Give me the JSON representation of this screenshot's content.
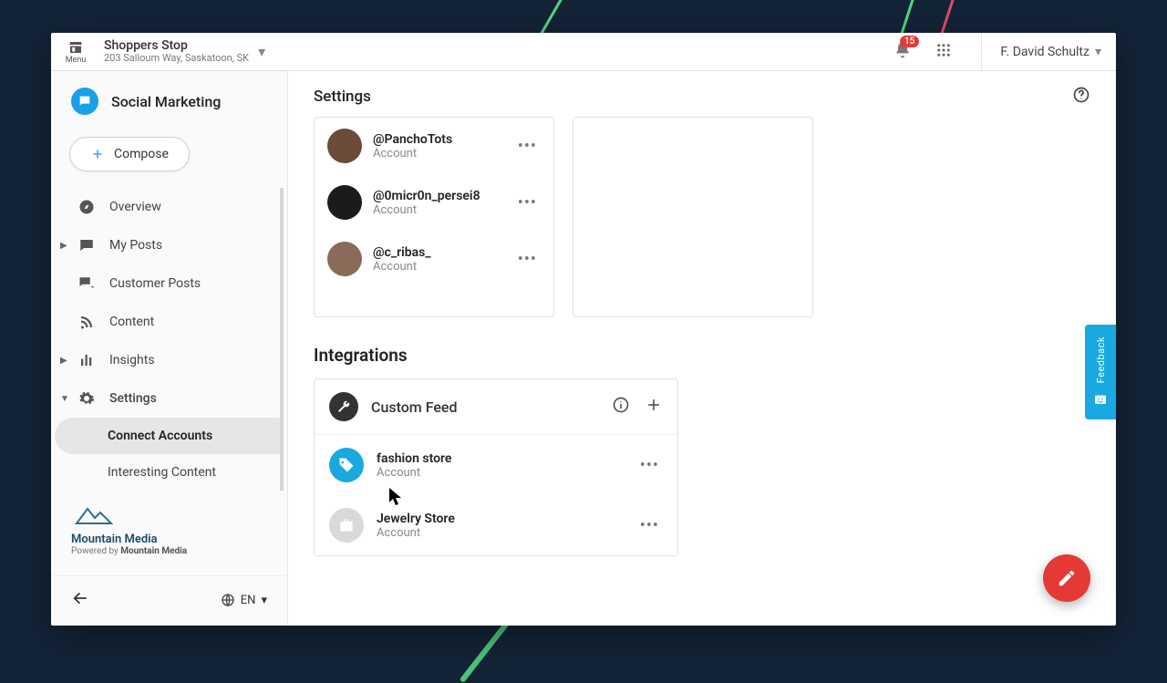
{
  "topbar": {
    "menu_label": "Menu",
    "location_name": "Shoppers Stop",
    "location_address": "203 Salloum Way, Saskatoon, SK",
    "notification_count": "15",
    "user_name": "F. David Schultz"
  },
  "sidebar": {
    "brand": "Social Marketing",
    "compose_label": "Compose",
    "items": [
      {
        "label": "Overview"
      },
      {
        "label": "My Posts"
      },
      {
        "label": "Customer Posts"
      },
      {
        "label": "Content"
      },
      {
        "label": "Insights"
      },
      {
        "label": "Settings"
      }
    ],
    "sub_items": [
      {
        "label": "Connect Accounts"
      },
      {
        "label": "Interesting Content"
      }
    ],
    "footer_brand": "Mountain Media",
    "powered_prefix": "Powered by ",
    "powered_name": "Mountain Media",
    "lang": "EN"
  },
  "main": {
    "title": "Settings",
    "accounts": [
      {
        "name": "@PanchoTots",
        "type": "Account"
      },
      {
        "name": "@0micr0n_persei8",
        "type": "Account"
      },
      {
        "name": "@c_ribas_",
        "type": "Account"
      }
    ],
    "integrations_heading": "Integrations",
    "integration_card_title": "Custom Feed",
    "integration_items": [
      {
        "name": "fashion store",
        "type": "Account"
      },
      {
        "name": "Jewelry Store",
        "type": "Account"
      }
    ]
  },
  "feedback_label": "Feedback"
}
